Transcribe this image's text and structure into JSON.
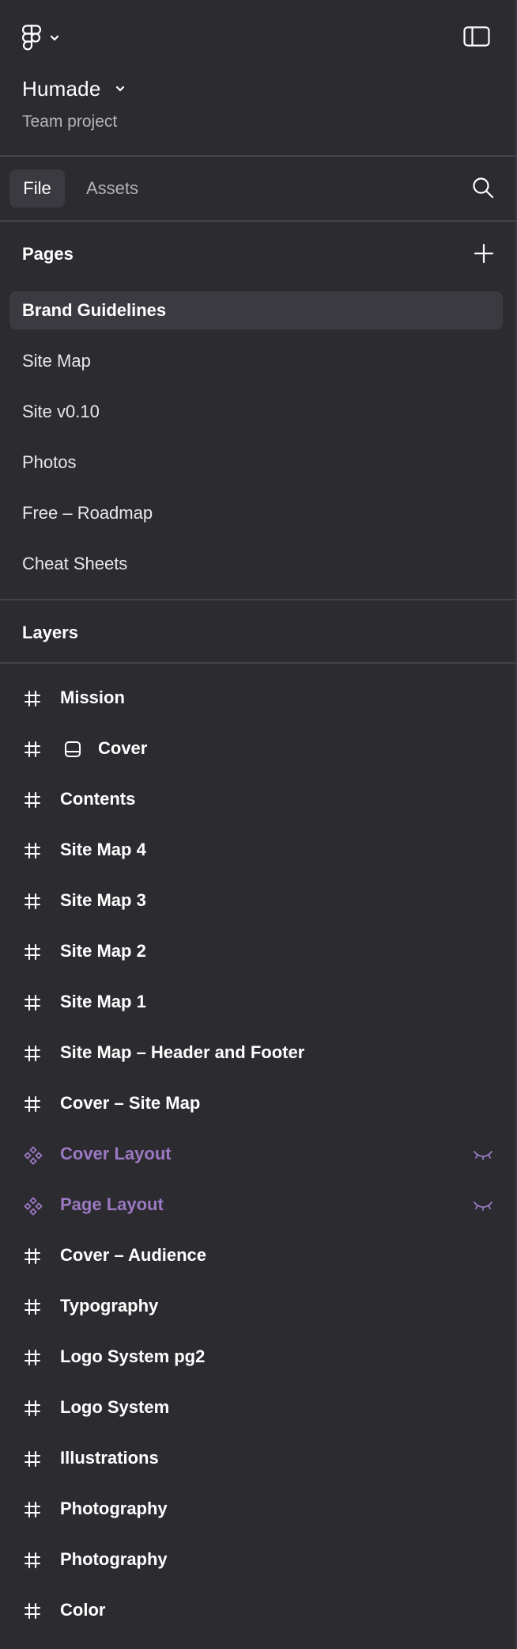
{
  "header": {
    "project_name": "Humade",
    "project_subtitle": "Team project",
    "logo_icon": "figma-logo-icon",
    "sidebar_toggle_icon": "sidebar-toggle-icon"
  },
  "tabs": [
    {
      "label": "File",
      "active": true
    },
    {
      "label": "Assets",
      "active": false
    }
  ],
  "pages_section": {
    "title": "Pages",
    "items": [
      {
        "label": "Brand Guidelines",
        "selected": true
      },
      {
        "label": "Site Map",
        "selected": false
      },
      {
        "label": "Site v0.10",
        "selected": false
      },
      {
        "label": "Photos",
        "selected": false
      },
      {
        "label": "Free – Roadmap",
        "selected": false
      },
      {
        "label": "Cheat Sheets",
        "selected": false
      }
    ]
  },
  "layers_section": {
    "title": "Layers",
    "items": [
      {
        "label": "Mission",
        "type": "frame",
        "icon": "frame-hash-icon"
      },
      {
        "label": "Cover",
        "type": "frame",
        "icon": "frame-hash-icon",
        "sub_icon": "instance-layout-icon"
      },
      {
        "label": "Contents",
        "type": "frame",
        "icon": "frame-hash-icon"
      },
      {
        "label": "Site Map 4",
        "type": "frame",
        "icon": "frame-hash-icon"
      },
      {
        "label": "Site Map 3",
        "type": "frame",
        "icon": "frame-hash-icon"
      },
      {
        "label": "Site Map 2",
        "type": "frame",
        "icon": "frame-hash-icon"
      },
      {
        "label": "Site Map 1",
        "type": "frame",
        "icon": "frame-hash-icon"
      },
      {
        "label": "Site Map – Header and Footer",
        "type": "frame",
        "icon": "frame-hash-icon"
      },
      {
        "label": "Cover – Site Map",
        "type": "frame",
        "icon": "frame-hash-icon"
      },
      {
        "label": "Cover Layout",
        "type": "component",
        "icon": "component-icon",
        "hidden": true
      },
      {
        "label": "Page Layout",
        "type": "component",
        "icon": "component-icon",
        "hidden": true
      },
      {
        "label": "Cover – Audience",
        "type": "frame",
        "icon": "frame-hash-icon"
      },
      {
        "label": "Typography",
        "type": "frame",
        "icon": "frame-hash-icon"
      },
      {
        "label": "Logo System pg2",
        "type": "frame",
        "icon": "frame-hash-icon"
      },
      {
        "label": "Logo System",
        "type": "frame",
        "icon": "frame-hash-icon"
      },
      {
        "label": "Illustrations",
        "type": "frame",
        "icon": "frame-hash-icon"
      },
      {
        "label": "Photography",
        "type": "frame",
        "icon": "frame-hash-icon"
      },
      {
        "label": "Photography",
        "type": "frame",
        "icon": "frame-hash-icon"
      },
      {
        "label": "Color",
        "type": "frame",
        "icon": "frame-hash-icon"
      }
    ]
  },
  "colors": {
    "panel_bg": "#2c2b30",
    "selected_bg": "#3b3a40",
    "divider": "#444349",
    "component_purple": "#9a79c2",
    "muted_text": "#b4b3b9"
  }
}
